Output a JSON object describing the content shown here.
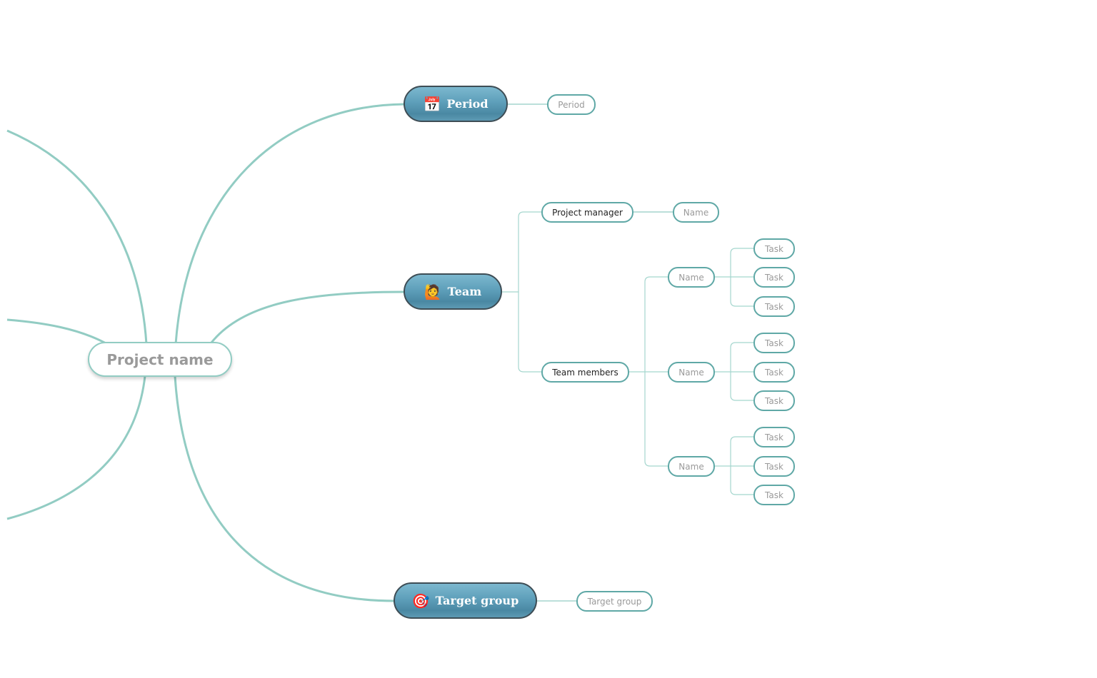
{
  "central": {
    "label": "Project name"
  },
  "branches": [
    {
      "label": "Period",
      "icon": "calendar-icon",
      "emoji": "📅",
      "children": [
        "Period"
      ]
    },
    {
      "label": "Team",
      "icon": "person-raising-hand-icon",
      "emoji": "🙋",
      "children": []
    },
    {
      "label": "Target group",
      "icon": "target-icon",
      "emoji": "🎯",
      "children": [
        "Target group"
      ]
    }
  ],
  "team": {
    "project_manager": {
      "label": "Project manager",
      "name": "Name"
    },
    "team_members": {
      "label": "Team members",
      "members": [
        {
          "name": "Name",
          "tasks": [
            "Task",
            "Task",
            "Task"
          ]
        },
        {
          "name": "Name",
          "tasks": [
            "Task",
            "Task",
            "Task"
          ]
        },
        {
          "name": "Name",
          "tasks": [
            "Task",
            "Task",
            "Task"
          ]
        }
      ]
    }
  },
  "colors": {
    "connector": "#92ccc3",
    "sub_border": "#5fa8a6",
    "main_node_top": "#7cb8cf",
    "main_node_bottom": "#4a88a3",
    "main_node_border": "#3e4d55",
    "placeholder_text": "#9a9a9a"
  }
}
